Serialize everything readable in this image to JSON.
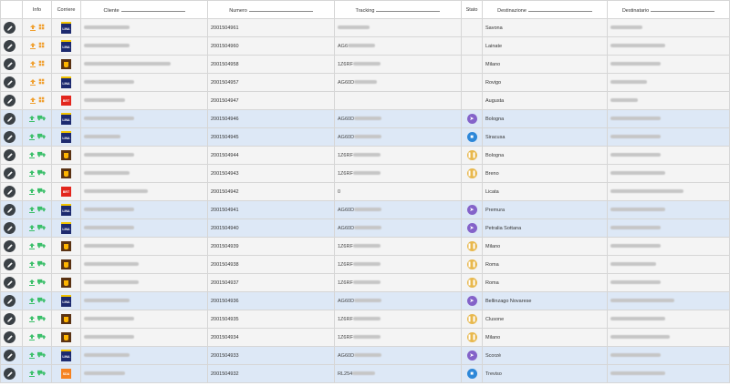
{
  "headers": {
    "info": "Info",
    "courier": "Corriere",
    "client": "Cliente",
    "number": "Numero",
    "tracking": "Tracking",
    "status": "Stato",
    "destination": "Destinazione",
    "recipient": "Destinatario"
  },
  "rows": [
    {
      "courier": "lina",
      "number": "2001504961",
      "tracking": "",
      "destination": "Savona",
      "status": "",
      "highlight": false,
      "info": "box"
    },
    {
      "courier": "lina",
      "number": "2001504960",
      "tracking": "AG6",
      "destination": "Lainate",
      "status": "",
      "highlight": false,
      "info": "box"
    },
    {
      "courier": "ups",
      "number": "2001504958",
      "tracking": "1Z6RF",
      "destination": "Milano",
      "status": "",
      "highlight": false,
      "info": "box"
    },
    {
      "courier": "lina",
      "number": "2001504957",
      "tracking": "AG60D",
      "destination": "Rovigo",
      "status": "",
      "highlight": false,
      "info": "box"
    },
    {
      "courier": "brt",
      "number": "2001504947",
      "tracking": "",
      "destination": "Augusta",
      "status": "",
      "highlight": false,
      "info": "box"
    },
    {
      "courier": "lina",
      "number": "2001504946",
      "tracking": "AG60D",
      "destination": "Bologna",
      "status": "purple",
      "highlight": true,
      "info": "truck"
    },
    {
      "courier": "lina",
      "number": "2001504945",
      "tracking": "AG60D",
      "destination": "Siracusa",
      "status": "blue",
      "highlight": true,
      "info": "truck"
    },
    {
      "courier": "ups",
      "number": "2001504944",
      "tracking": "1Z6RF",
      "destination": "Bologna",
      "status": "yellow",
      "highlight": false,
      "info": "truck"
    },
    {
      "courier": "ups",
      "number": "2001504943",
      "tracking": "1Z6RF",
      "destination": "Breno",
      "status": "yellow",
      "highlight": false,
      "info": "truck"
    },
    {
      "courier": "brt",
      "number": "2001504942",
      "tracking": "0",
      "destination": "Licata",
      "status": "",
      "highlight": false,
      "info": "truck"
    },
    {
      "courier": "lina",
      "number": "2001504941",
      "tracking": "AG60D",
      "destination": "Premura",
      "status": "purple",
      "highlight": true,
      "info": "truck"
    },
    {
      "courier": "lina",
      "number": "2001504940",
      "tracking": "AG60D",
      "destination": "Petralia Sottana",
      "status": "purple",
      "highlight": true,
      "info": "truck"
    },
    {
      "courier": "ups",
      "number": "2001504939",
      "tracking": "1Z6RF",
      "destination": "Milano",
      "status": "yellow",
      "highlight": false,
      "info": "truck"
    },
    {
      "courier": "ups",
      "number": "2001504938",
      "tracking": "1Z6RF",
      "destination": "Roma",
      "status": "yellow",
      "highlight": false,
      "info": "truck"
    },
    {
      "courier": "ups",
      "number": "2001504937",
      "tracking": "1Z6RF",
      "destination": "Roma",
      "status": "yellow",
      "highlight": false,
      "info": "truck"
    },
    {
      "courier": "lina",
      "number": "2001504936",
      "tracking": "AG60D",
      "destination": "Bellinzago Novarese",
      "status": "purple",
      "highlight": true,
      "info": "truck"
    },
    {
      "courier": "ups",
      "number": "2001504935",
      "tracking": "1Z6RF",
      "destination": "Clusone",
      "status": "yellow",
      "highlight": false,
      "info": "truck"
    },
    {
      "courier": "ups",
      "number": "2001504934",
      "tracking": "1Z6RF",
      "destination": "Milano",
      "status": "yellow",
      "highlight": false,
      "info": "truck"
    },
    {
      "courier": "lina",
      "number": "2001504933",
      "tracking": "AG60D",
      "destination": "Scorzè",
      "status": "purple",
      "highlight": true,
      "info": "truck"
    },
    {
      "courier": "sda",
      "number": "2001504932",
      "tracking": "RL254",
      "destination": "Treviso",
      "status": "blue",
      "highlight": true,
      "info": "truck"
    }
  ],
  "courier_labels": {
    "lina": "LINA",
    "brt": "BRT",
    "sda": "SDA"
  }
}
